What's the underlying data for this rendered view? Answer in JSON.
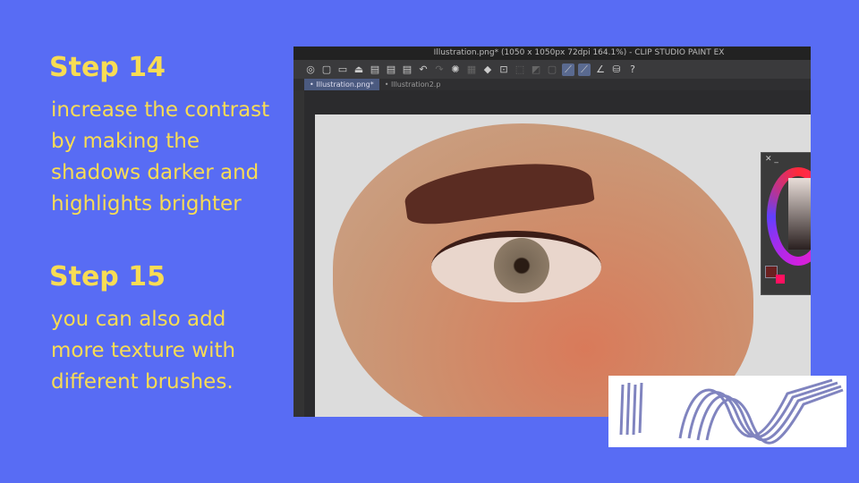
{
  "steps": [
    {
      "title": "Step 14",
      "text": "increase the contrast by making the shadows darker and highlights brighter"
    },
    {
      "title": "Step 15",
      "text": "you can also add more texture with different brushes."
    }
  ],
  "app": {
    "title": "Illustration.png* (1050 x 1050px 72dpi 164.1%) - CLIP STUDIO PAINT EX",
    "tabs": [
      "Illustration.png*",
      "Illustration2.p"
    ],
    "palette_controls": [
      "✕",
      "_"
    ]
  },
  "colors": {
    "background": "#586cf4",
    "text": "#f8dc54"
  }
}
